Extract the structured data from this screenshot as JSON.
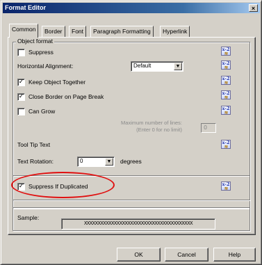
{
  "window": {
    "title": "Format Editor",
    "close_glyph": "×"
  },
  "tabs": [
    {
      "label": "Common",
      "active": true
    },
    {
      "label": "Border",
      "active": false
    },
    {
      "label": "Font",
      "active": false
    },
    {
      "label": "Paragraph Formatting",
      "active": false
    },
    {
      "label": "Hyperlink",
      "active": false
    }
  ],
  "object_format": {
    "caption": "Object format",
    "suppress": {
      "label": "Suppress",
      "checked": false
    },
    "horizontal_alignment": {
      "label": "Horizontal Alignment:",
      "value": "Default"
    },
    "keep_object_together": {
      "label": "Keep Object Together",
      "checked": true
    },
    "close_border": {
      "label": "Close Border on Page Break",
      "checked": true
    },
    "can_grow": {
      "label": "Can Grow",
      "checked": false
    },
    "max_lines_hint": "Maximum number of lines:",
    "max_lines_hint2": "(Enter 0 for no limit)",
    "max_lines_value": "0",
    "tooltip_label": "Tool Tip Text",
    "text_rotation": {
      "label": "Text Rotation:",
      "value": "0",
      "unit": "degrees"
    }
  },
  "suppress_if_duplicated": {
    "label": "Suppress If Duplicated",
    "checked": true
  },
  "sample": {
    "label": "Sample:",
    "text": "XXXXXXXXXXXXXXXXXXXXXXXXXXXXXXXXXXXXXXXX"
  },
  "buttons": {
    "ok": "OK",
    "cancel": "Cancel",
    "help": "Help"
  },
  "formula_icon": {
    "top": "x-2",
    "bottom": "≋"
  },
  "check_mark": "✓",
  "combo_arrow": "▼",
  "colors": {
    "title_start": "#0a246a",
    "title_end": "#a6caf0",
    "highlight_ring": "#e01010",
    "face": "#d4d0c8"
  }
}
